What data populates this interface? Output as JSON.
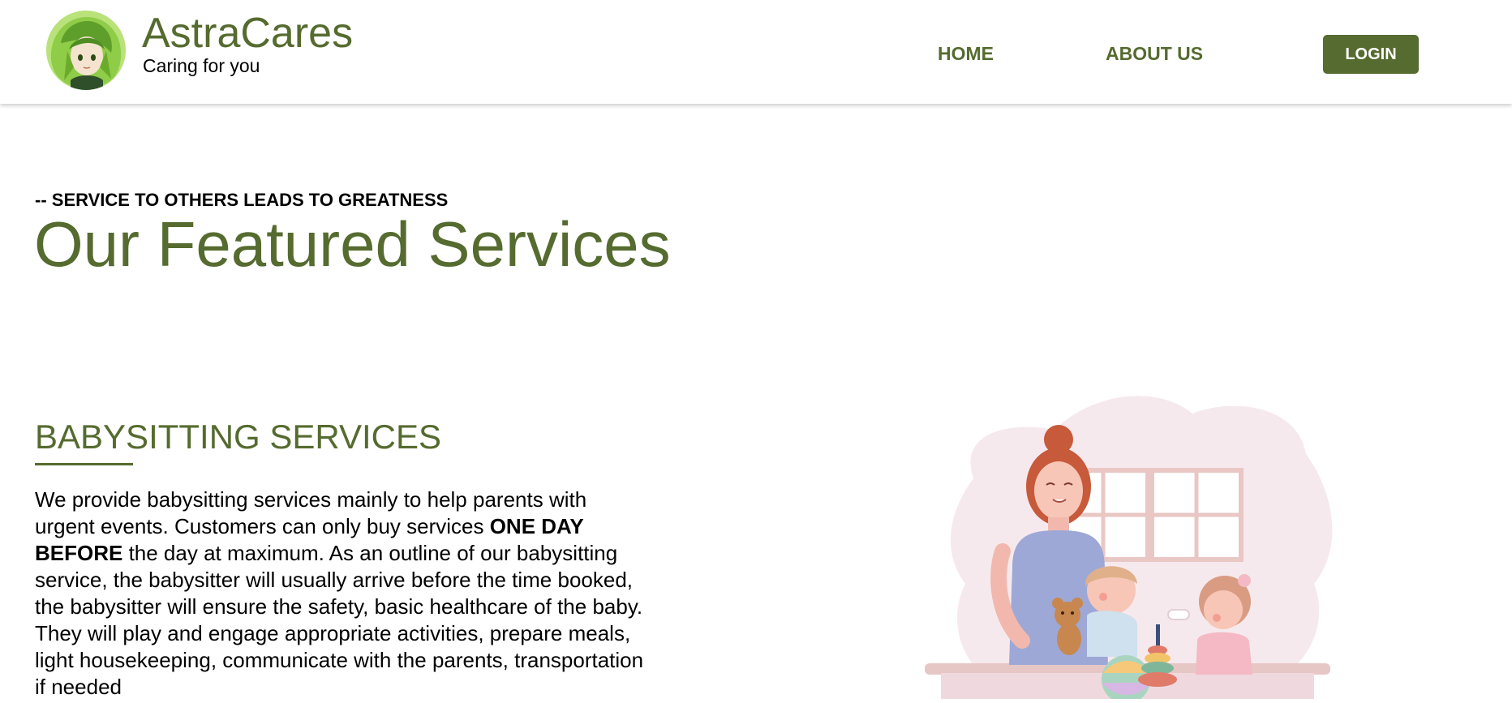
{
  "header": {
    "brand_name": "AstraCares",
    "tagline": "Caring for you",
    "logo_icon": "anime-girl-avatar-logo",
    "nav": [
      {
        "label": "HOME"
      },
      {
        "label": "ABOUT US"
      }
    ],
    "login_label": "LOGIN"
  },
  "hero": {
    "eyebrow": "-- SERVICE TO OTHERS LEADS TO GREATNESS",
    "title": "Our Featured Services"
  },
  "service": {
    "heading": "BABYSITTING SERVICES",
    "desc_part1": "We provide babysitting services mainly to help parents with urgent events. Customers can only buy services ",
    "desc_bold": "ONE DAY BEFORE",
    "desc_part2": " the day at maximum. As an outline of our babysitting service, the babysitter will usually arrive before the time booked, the babysitter will ensure the safety, basic healthcare of the baby. They will play and engage appropriate activities, prepare meals, light housekeeping, communicate with the parents, transportation if needed",
    "illustration_icon": "babysitter-with-children-illustration"
  },
  "colors": {
    "accent": "#556b2f",
    "background": "#ffffff",
    "text": "#000000",
    "button_text": "#ffffff"
  }
}
